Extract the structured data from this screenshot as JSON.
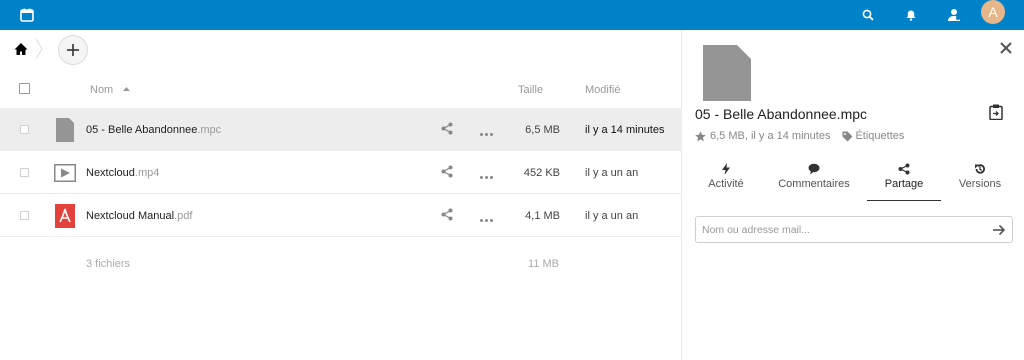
{
  "header": {
    "avatar_letter": "A",
    "brand_color": "#0082c9"
  },
  "files": {
    "columns": {
      "name": "Nom",
      "size": "Taille",
      "modified": "Modifié"
    },
    "rows": [
      {
        "name": "05 - Belle Abandonnee",
        "ext": ".mpc",
        "size": "6,5 MB",
        "modified": "il y a 14 minutes",
        "icon": "generic-file-icon",
        "selected": true
      },
      {
        "name": "Nextcloud",
        "ext": ".mp4",
        "size": "452 KB",
        "modified": "il y a un an",
        "icon": "video-file-icon",
        "selected": false
      },
      {
        "name": "Nextcloud Manual",
        "ext": ".pdf",
        "size": "4,1 MB",
        "modified": "il y a un an",
        "icon": "pdf-file-icon",
        "selected": false
      }
    ],
    "summary": {
      "count": "3 fichiers",
      "total_size": "11 MB"
    }
  },
  "details": {
    "title": "05 - Belle Abandonnee.mpc",
    "meta": "6,5 MB, il y a 14 minutes",
    "tags_label": "Étiquettes",
    "tabs": [
      {
        "label": "Activité",
        "icon": "lightning-icon"
      },
      {
        "label": "Commentaires",
        "icon": "comment-icon"
      },
      {
        "label": "Partage",
        "icon": "share-icon"
      },
      {
        "label": "Versions",
        "icon": "history-icon"
      }
    ],
    "share_placeholder": "Nom ou adresse mail..."
  }
}
